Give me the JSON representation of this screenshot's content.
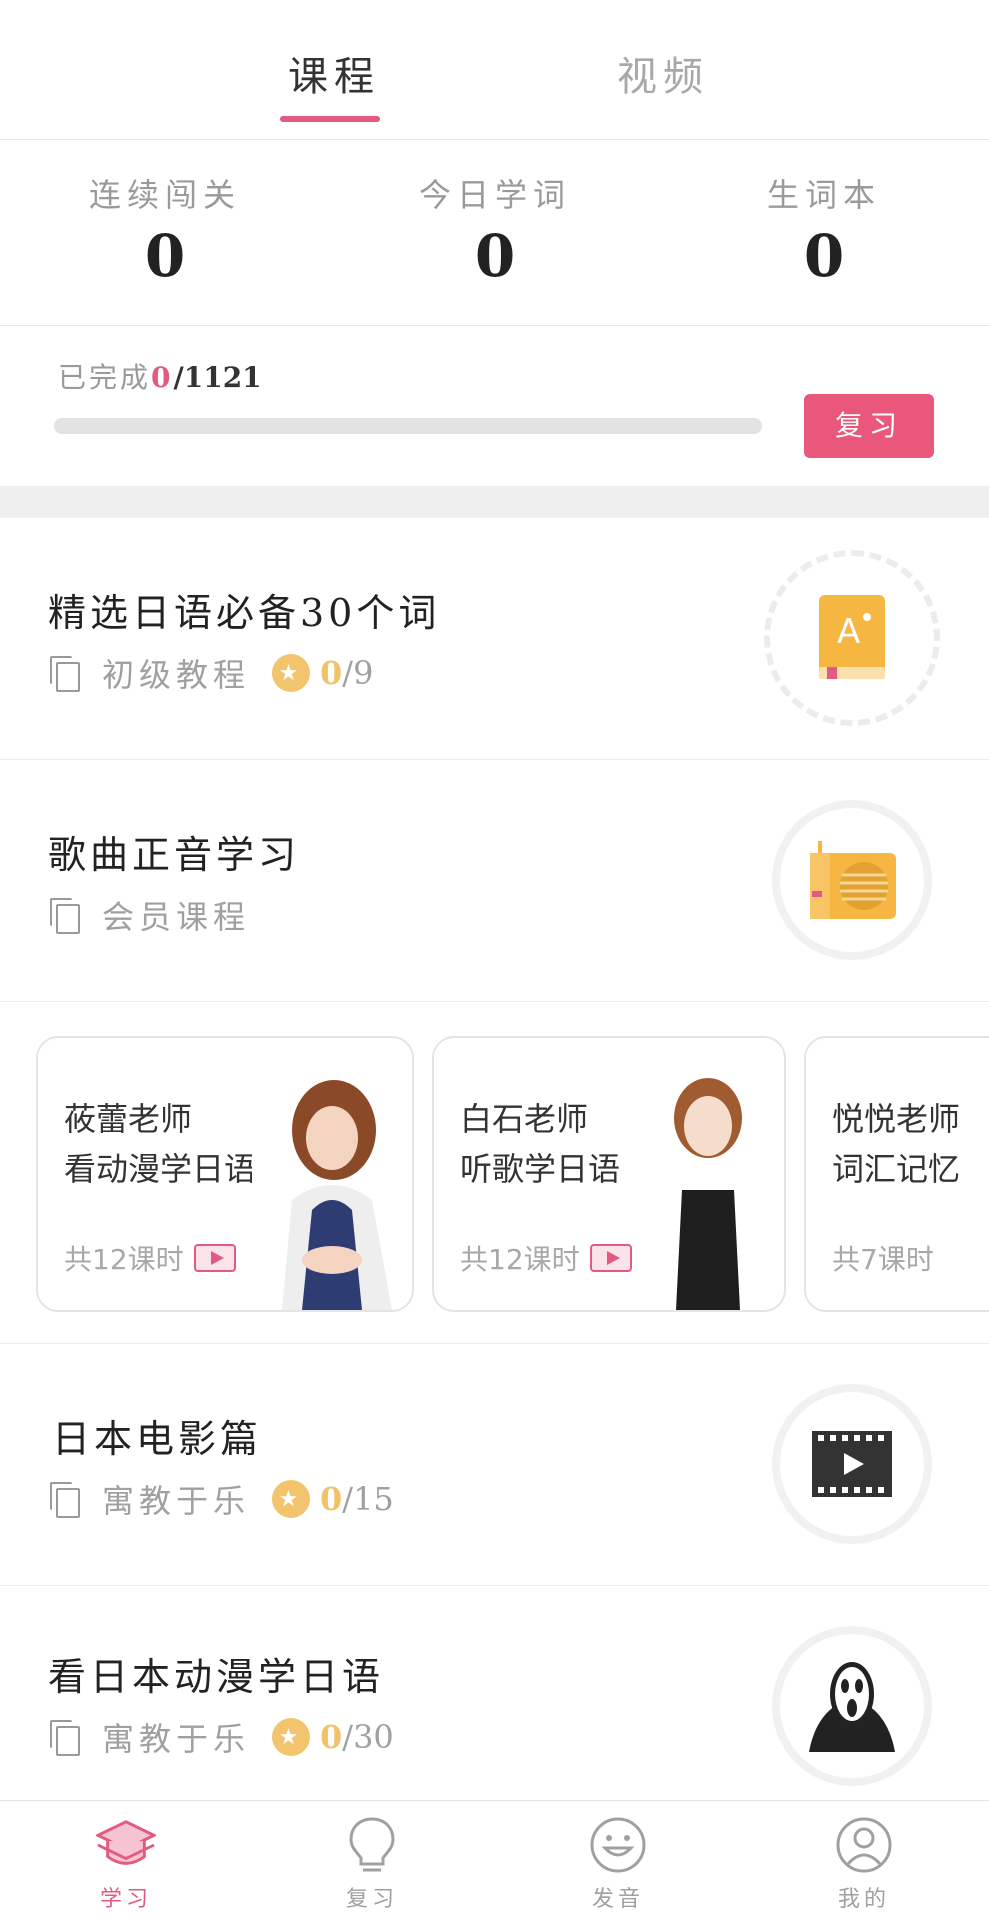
{
  "tabs": [
    {
      "label": "课程",
      "active": true
    },
    {
      "label": "视频",
      "active": false
    }
  ],
  "stats": [
    {
      "label": "连续闯关",
      "value": "0"
    },
    {
      "label": "今日学词",
      "value": "0"
    },
    {
      "label": "生词本",
      "value": "0"
    }
  ],
  "progress": {
    "prefix": "已完成",
    "done": "0",
    "total": "/1121",
    "fraction": 0,
    "review_label": "复习"
  },
  "courses": [
    {
      "title": "精选日语必备30个词",
      "tag": "初级教程",
      "done": "0",
      "total": "/9",
      "icon": "vocabulary-book-icon"
    },
    {
      "title": "歌曲正音学习",
      "tag": "会员课程",
      "icon": "radio-icon"
    },
    {
      "title": "日本电影篇",
      "tag": "寓教于乐",
      "done": "0",
      "total": "/15",
      "icon": "film-play-icon"
    },
    {
      "title": "看日本动漫学日语",
      "tag": "寓教于乐",
      "done": "0",
      "total": "/30",
      "icon": "scream-mask-icon"
    }
  ],
  "teacher_cards": [
    {
      "name": "莜蕾老师",
      "subtitle": "看动漫学日语",
      "lessons": "共12课时"
    },
    {
      "name": "白石老师",
      "subtitle": "听歌学日语",
      "lessons": "共12课时"
    },
    {
      "name": "悦悦老师",
      "subtitle": "词汇记忆",
      "lessons": "共7课时"
    }
  ],
  "nav": [
    {
      "label": "学习",
      "icon": "graduation-cap-icon",
      "active": true
    },
    {
      "label": "复习",
      "icon": "lightbulb-icon",
      "active": false
    },
    {
      "label": "发音",
      "icon": "smile-face-icon",
      "active": false
    },
    {
      "label": "我的",
      "icon": "user-icon",
      "active": false
    }
  ],
  "colors": {
    "accent": "#e25a7f",
    "star": "#f2c46e",
    "icon_orange": "#f5b642"
  }
}
